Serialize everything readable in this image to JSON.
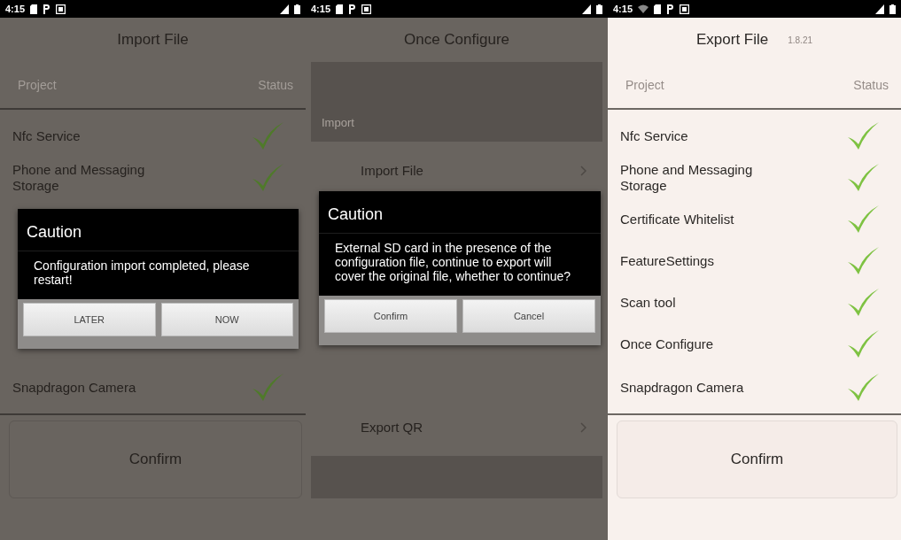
{
  "screens": [
    {
      "kind": "status_list",
      "dimmed": true,
      "status_bar": {
        "time": "4:15",
        "wifi": false
      },
      "title": "Import File",
      "columns": [
        "Project",
        "Status"
      ],
      "rows": [
        {
          "name": "Nfc Service",
          "done": true
        },
        {
          "name": "Phone and Messaging Storage",
          "done": true
        },
        {
          "name": "Snapdragon Camera",
          "done": true
        }
      ],
      "confirm": "Confirm",
      "dialog": {
        "title": "Caution",
        "message": "Configuration import completed, please restart!",
        "buttons": [
          "LATER",
          "NOW"
        ]
      }
    },
    {
      "kind": "menu",
      "dimmed": true,
      "status_bar": {
        "time": "4:15",
        "wifi": false
      },
      "title": "Once Configure",
      "sections": [
        {
          "header": "Import",
          "items": [
            "Import File"
          ]
        },
        {
          "items": [
            "Export QR"
          ]
        }
      ],
      "dialog": {
        "title": "Caution",
        "message": "External SD card in the presence of the configuration file, continue to export will cover the original file, whether to continue?",
        "buttons": [
          "Confirm",
          "Cancel"
        ]
      }
    },
    {
      "kind": "status_list",
      "dimmed": false,
      "status_bar": {
        "time": "4:15",
        "wifi": true
      },
      "title": "Export File",
      "version": "1.8.21",
      "columns": [
        "Project",
        "Status"
      ],
      "rows": [
        {
          "name": "Nfc Service",
          "done": true
        },
        {
          "name": "Phone and Messaging Storage",
          "done": true
        },
        {
          "name": "Certificate Whitelist",
          "done": true
        },
        {
          "name": "FeatureSettings",
          "done": true
        },
        {
          "name": "Scan tool",
          "done": true
        },
        {
          "name": "Once Configure",
          "done": true
        },
        {
          "name": "Snapdragon Camera",
          "done": true
        }
      ],
      "confirm": "Confirm"
    }
  ]
}
